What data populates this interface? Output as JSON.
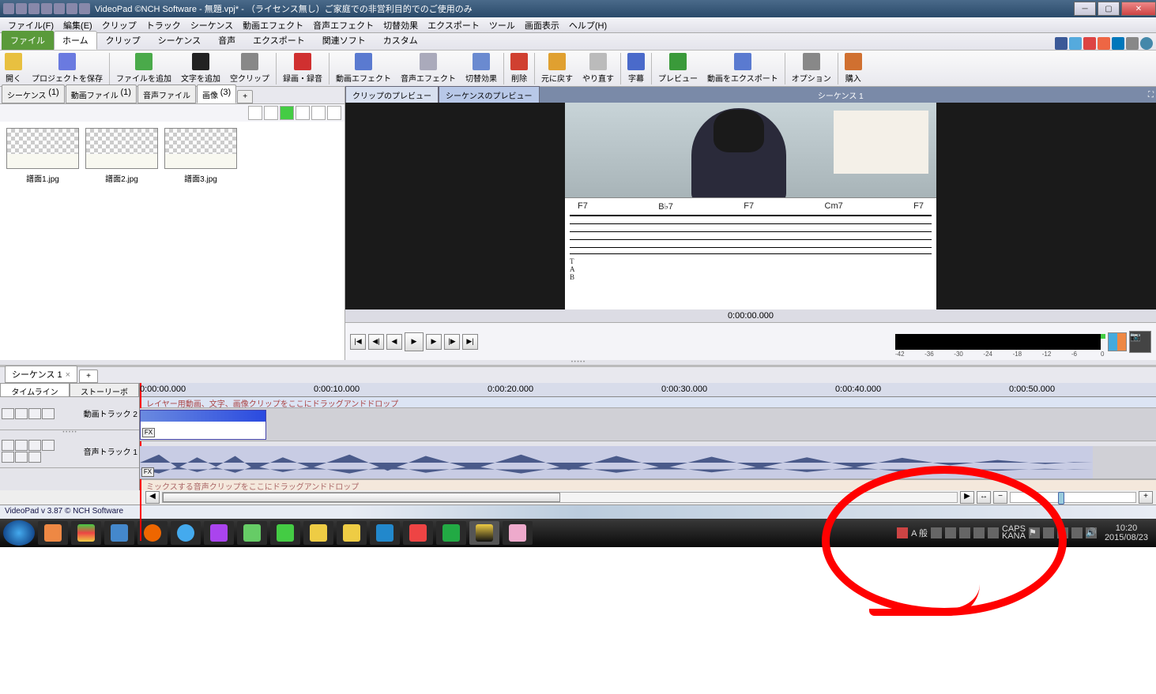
{
  "window": {
    "title": "VideoPad ©NCH Software - 無題.vpj* - （ライセンス無し）ご家庭での非営利目的でのご使用のみ"
  },
  "menubar": [
    "ファイル(F)",
    "編集(E)",
    "クリップ",
    "トラック",
    "シーケンス",
    "動画エフェクト",
    "音声エフェクト",
    "切替効果",
    "エクスポート",
    "ツール",
    "画面表示",
    "ヘルプ(H)"
  ],
  "ribbon_tabs": {
    "file": "ファイル",
    "items": [
      "ホーム",
      "クリップ",
      "シーケンス",
      "音声",
      "エクスポート",
      "関連ソフト",
      "カスタム"
    ],
    "active": "ホーム"
  },
  "toolbar": [
    {
      "id": "open",
      "label": "開く",
      "color": "#e8c040"
    },
    {
      "id": "save",
      "label": "プロジェクトを保存",
      "color": "#6a7ae0"
    },
    {
      "id": "addfile",
      "label": "ファイルを追加",
      "color": "#4aaa4a"
    },
    {
      "id": "addtext",
      "label": "文字を追加",
      "color": "#222"
    },
    {
      "id": "blank",
      "label": "空クリップ",
      "color": "#888"
    },
    {
      "id": "record",
      "label": "録画・録音",
      "color": "#d03030"
    },
    {
      "id": "vfx",
      "label": "動画エフェクト",
      "color": "#5a7ad0"
    },
    {
      "id": "afx",
      "label": "音声エフェクト",
      "color": "#aab"
    },
    {
      "id": "trans",
      "label": "切替効果",
      "color": "#6a8ad0"
    },
    {
      "id": "delete",
      "label": "削除",
      "color": "#d04030"
    },
    {
      "id": "undo",
      "label": "元に戻す",
      "color": "#e0a030"
    },
    {
      "id": "redo",
      "label": "やり直す",
      "color": "#bbb"
    },
    {
      "id": "sub",
      "label": "字幕",
      "color": "#4a6aca"
    },
    {
      "id": "preview",
      "label": "プレビュー",
      "color": "#3a9a3a"
    },
    {
      "id": "export",
      "label": "動画をエクスポート",
      "color": "#5a7ad0"
    },
    {
      "id": "options",
      "label": "オプション",
      "color": "#888"
    },
    {
      "id": "buy",
      "label": "購入",
      "color": "#d07030"
    }
  ],
  "bin_tabs": [
    {
      "label": "シーケンス",
      "count": "(1)"
    },
    {
      "label": "動画ファイル",
      "count": "(1)"
    },
    {
      "label": "音声ファイル",
      "count": ""
    },
    {
      "label": "画像",
      "count": "(3)",
      "active": true
    }
  ],
  "bin_add": "+",
  "thumbs": [
    "譜面1.jpg",
    "譜面2.jpg",
    "譜面3.jpg"
  ],
  "preview": {
    "tab_clip": "クリップのプレビュー",
    "tab_seq": "シーケンスのプレビュー",
    "seq_label": "シーケンス 1",
    "chords": [
      "F7",
      "B♭7",
      "F7",
      "Cm7",
      "F7"
    ],
    "time": "0:00:00.000",
    "meter_labels": [
      "-42",
      "-36",
      "-30",
      "-24",
      "-18",
      "-12",
      "-6",
      "0"
    ]
  },
  "seq_tab": {
    "label": "シーケンス 1",
    "add": "+"
  },
  "view_tabs": {
    "timeline": "タイムライン",
    "story": "ストーリーボ"
  },
  "ruler": [
    "0:00:00.000",
    "0:00:10.000",
    "0:00:20.000",
    "0:00:30.000",
    "0:00:40.000",
    "0:00:50.000"
  ],
  "drop_video": "レイヤー用動画、文字、画像クリップをここにドラッグアンドドロップ",
  "drop_audio": "ミックスする音声クリップをここにドラッグアンドドロップ",
  "tracks": {
    "video": "動画トラック 2",
    "audio": "音声トラック 1",
    "fx": "FX"
  },
  "status": "VideoPad v 3.87 © NCH Software",
  "taskbar": {
    "ime": {
      "caps": "CAPS",
      "kana": "KANA",
      "a": "A 般"
    },
    "time": "10:20",
    "date": "2015/08/23"
  },
  "zoom": {
    "minus": "−",
    "plus": "+"
  }
}
